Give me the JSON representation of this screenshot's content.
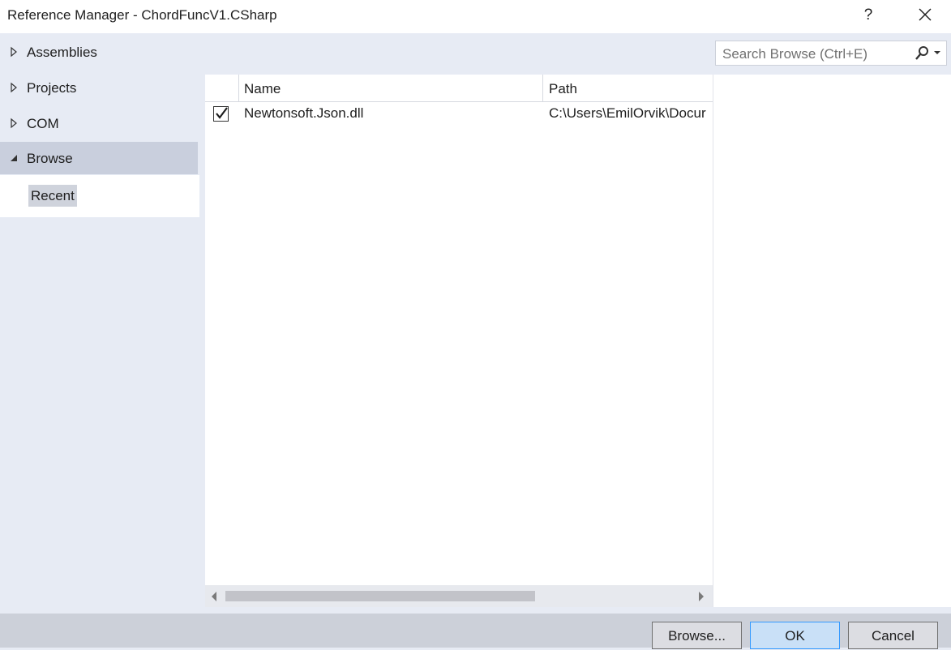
{
  "window": {
    "title": "Reference Manager - ChordFuncV1.CSharp",
    "help_label": "?",
    "close_icon": "close-icon"
  },
  "nav": {
    "items": [
      {
        "label": "Assemblies",
        "expanded": false
      },
      {
        "label": "Projects",
        "expanded": false
      },
      {
        "label": "COM",
        "expanded": false
      },
      {
        "label": "Browse",
        "expanded": true,
        "selected": true
      }
    ],
    "browse_children": [
      {
        "label": "Recent"
      }
    ]
  },
  "search": {
    "placeholder": "Search Browse (Ctrl+E)",
    "value": "",
    "icon": "search-icon"
  },
  "list": {
    "columns": [
      "",
      "Name",
      "Path"
    ],
    "rows": [
      {
        "checked": true,
        "name": "Newtonsoft.Json.dll",
        "path": "C:\\Users\\EmilOrvik\\Docur"
      }
    ]
  },
  "footer": {
    "browse_label": "Browse...",
    "ok_label": "OK",
    "cancel_label": "Cancel"
  },
  "colors": {
    "background": "#e7ebf4",
    "selected_nav": "#c9cfdd",
    "ok_border": "#3399ff",
    "ok_fill": "#c9e0f7"
  }
}
